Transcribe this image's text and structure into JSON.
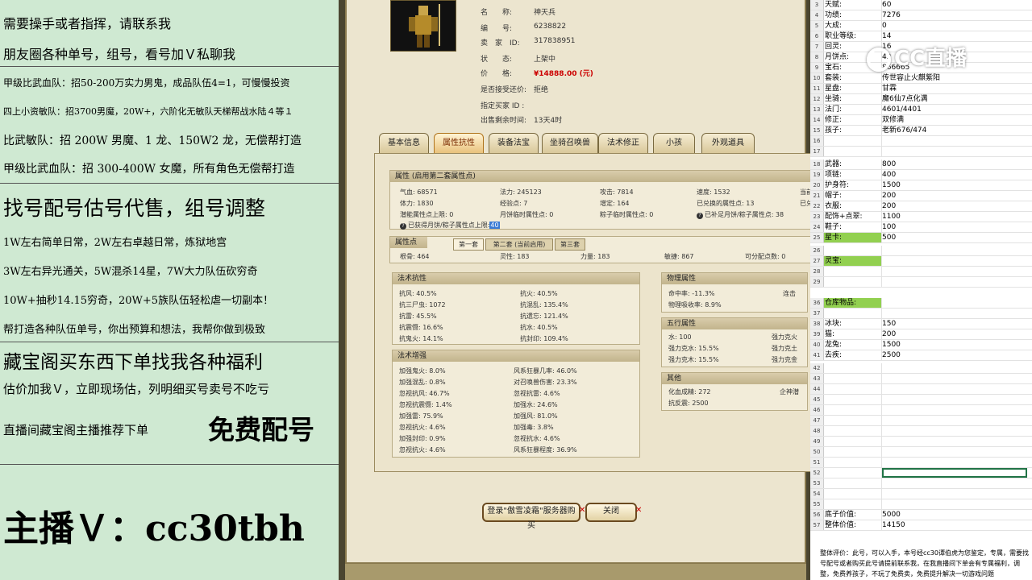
{
  "left_panel": {
    "lines": [
      "需要操手或者指挥，请联系我",
      "朋友圈各种单号，组号，看号加Ｖ私聊我",
      "甲级比武血队：招50-200万实力男鬼，成品队伍4=1，可慢慢投资",
      "四上小资敏队：招3700男魔，20W+，六阶化无敏队天梯帮战水陆４等１",
      "比武敏队：招 200W 男魔、1 龙、150W2 龙，无偿帮打造",
      "甲级比武血队：招 300-400W 女魔，所有角色无偿帮打造",
      "找号配号估号代售，组号调整",
      "1W左右简单日常，2W左右卓越日常，炼狱地宫",
      "3W左右异光通关，5W混杀14星，7W大力队伍砍穷奇",
      "10W+抽秒14.15穷奇，20W+5族队伍轻松虐一切副本！",
      "帮打造各种队伍单号，你出预算和想法，我帮你做到极致",
      "藏宝阁买东西下单找我各种福利",
      "估价加我Ｖ，立即现场估，列明细买号卖号不吃亏",
      "直播间藏宝阁主播推荐下单",
      "免费配号",
      "主播Ｖ：cc30tbh"
    ]
  },
  "game": {
    "info": {
      "name_label": "名　　称:",
      "name_value": "神天兵",
      "id_label": "编　　号:",
      "id_value": "6238822",
      "seller_label": "卖　家　ID:",
      "seller_value": "317838951",
      "status_label": "状　　态:",
      "status_value": "上架中",
      "price_label": "价　　格:",
      "price_value": "¥14888.00 (元)",
      "bargain_label": "是否接受还价:",
      "bargain_value": "拒绝",
      "buyer_label": "指定买家 ID :",
      "time_label": "出售剩余时间:",
      "time_value": "13天4时"
    },
    "tabs": [
      "基本信息",
      "属性抗性",
      "装备法宝",
      "坐骑召唤兽",
      "法术修正",
      "小孩",
      "外观道具"
    ],
    "attr_header": "属性 (启用第二套属性点)",
    "attrs": [
      [
        "气血: 68571",
        "法力: 245123",
        "攻击: 7814",
        "速度: 1532",
        "当前"
      ],
      [
        "体力: 1830",
        "经验点: 7",
        "增定: 164",
        "已兑换的属性点: 13",
        "已兑"
      ],
      [
        "潜能属性点上限: 0",
        "月饼临时属性点: 0",
        "粽子临时属性点: 0",
        "已补足月饼/粽子属性点: 38",
        ""
      ]
    ],
    "attr_note": "已获得月饼/粽子属性点上限:",
    "attr_note_value": "40",
    "points_header": "属性点",
    "sub_tabs": [
      "第一套",
      "第二套 (当前启用)",
      "第三套"
    ],
    "points": [
      "根骨: 464",
      "灵性: 183",
      "力量: 183",
      "敏捷: 867",
      "可分配点数: 0"
    ],
    "resist_header": "法术抗性",
    "resists": [
      [
        "抗风: 40.5%",
        "抗火: 40.5%"
      ],
      [
        "抗三尸虫: 1072",
        "抗混乱: 135.4%"
      ],
      [
        "抗雷: 45.5%",
        "抗遗忘: 121.4%"
      ],
      [
        "抗震慑: 16.6%",
        "抗水: 40.5%"
      ],
      [
        "抗鬼火: 14.1%",
        "抗封印: 109.4%"
      ]
    ],
    "boost_header": "法术增强",
    "boosts": [
      [
        "加强鬼火: 8.0%",
        "风系狂暴几率: 46.0%"
      ],
      [
        "加强混乱: 0.8%",
        "对召唤兽伤害: 23.3%"
      ],
      [
        "忽视抗风: 46.7%",
        "忽视抗雷: 4.6%"
      ],
      [
        "忽视抗震慑: 1.4%",
        "加强水: 24.6%"
      ],
      [
        "加强雷: 75.9%",
        "加强风: 81.0%"
      ],
      [
        "忽视抗火: 4.6%",
        "加强毒: 3.8%"
      ],
      [
        "加强封印: 0.9%",
        "忽视抗水: 4.6%"
      ],
      [
        "忽视抗火: 4.6%",
        "风系狂暴程度: 36.9%"
      ]
    ],
    "phys_header": "物理属性",
    "phys": [
      [
        "命中率: -11.3%",
        "连击"
      ],
      [
        "物理吸收率: 8.9%",
        ""
      ]
    ],
    "five_header": "五行属性",
    "five": [
      [
        "水: 100",
        "强力克火"
      ],
      [
        "强力克水: 15.5%",
        "强力克土"
      ],
      [
        "强力克木: 15.5%",
        "强力克金"
      ]
    ],
    "other_header": "其他",
    "other": [
      [
        "化血成精: 272",
        "企神潜"
      ],
      [
        "抗反震: 2500",
        ""
      ]
    ],
    "login_button": "登录\"傲雪凌霜\"服务器购买",
    "close_button": "关闭"
  },
  "logo": {
    "text": "CC直播"
  },
  "sheet": {
    "rows": [
      {
        "n": "3",
        "a": "天赋:",
        "b": "60"
      },
      {
        "n": "4",
        "a": "功绩:",
        "b": "7276"
      },
      {
        "n": "5",
        "a": "大成:",
        "b": "0"
      },
      {
        "n": "6",
        "a": "职业等级:",
        "b": "14"
      },
      {
        "n": "7",
        "a": "回灵:",
        "b": "16"
      },
      {
        "n": "8",
        "a": "月饼点:",
        "b": "42"
      },
      {
        "n": "9",
        "a": "宝石:",
        "b": "866665"
      },
      {
        "n": "10",
        "a": "套装:",
        "b": "传世容止火麒紫阳"
      },
      {
        "n": "11",
        "a": "星盘:",
        "b": "甘霖"
      },
      {
        "n": "12",
        "a": "坐骑:",
        "b": "魔6仙7点化满"
      },
      {
        "n": "13",
        "a": "法门:",
        "b": "4601/4401"
      },
      {
        "n": "14",
        "a": "修正:",
        "b": "双修满"
      },
      {
        "n": "15",
        "a": "孩子:",
        "b": "老新676/474"
      },
      {
        "n": "16",
        "a": "",
        "b": ""
      },
      {
        "n": "17",
        "a": "",
        "b": ""
      },
      {
        "n": "18",
        "a": "武器:",
        "b": "800"
      },
      {
        "n": "19",
        "a": "项链:",
        "b": "400"
      },
      {
        "n": "20",
        "a": "护身符:",
        "b": "1500"
      },
      {
        "n": "21",
        "a": "帽子:",
        "b": "200"
      },
      {
        "n": "22",
        "a": "衣服:",
        "b": "200"
      },
      {
        "n": "23",
        "a": "配饰+点翠:",
        "b": "1100"
      },
      {
        "n": "24",
        "a": "鞋子:",
        "b": "100"
      },
      {
        "n": "25",
        "a": "星卡:",
        "b": "500",
        "hl": "green"
      },
      {
        "n": "26",
        "a": "",
        "b": ""
      },
      {
        "n": "27",
        "a": "灵宝:",
        "b": "",
        "hl": "green"
      },
      {
        "n": "28",
        "a": "",
        "b": ""
      },
      {
        "n": "29",
        "a": "",
        "b": ""
      },
      {
        "n": "36",
        "a": "仓库物品:",
        "b": "",
        "hl": "green"
      },
      {
        "n": "37",
        "a": "",
        "b": ""
      },
      {
        "n": "38",
        "a": "冰块:",
        "b": "150"
      },
      {
        "n": "39",
        "a": "猫:",
        "b": "200"
      },
      {
        "n": "40",
        "a": "龙兔:",
        "b": "1500"
      },
      {
        "n": "41",
        "a": "去疾:",
        "b": "2500"
      },
      {
        "n": "42",
        "a": "",
        "b": ""
      },
      {
        "n": "43",
        "a": "",
        "b": ""
      },
      {
        "n": "44",
        "a": "",
        "b": ""
      },
      {
        "n": "45",
        "a": "",
        "b": ""
      },
      {
        "n": "46",
        "a": "",
        "b": ""
      },
      {
        "n": "47",
        "a": "",
        "b": ""
      },
      {
        "n": "48",
        "a": "",
        "b": ""
      },
      {
        "n": "49",
        "a": "",
        "b": ""
      },
      {
        "n": "50",
        "a": "",
        "b": ""
      },
      {
        "n": "51",
        "a": "",
        "b": ""
      },
      {
        "n": "52",
        "a": "",
        "b": "",
        "sel": true
      },
      {
        "n": "53",
        "a": "",
        "b": ""
      },
      {
        "n": "54",
        "a": "",
        "b": ""
      },
      {
        "n": "55",
        "a": "",
        "b": ""
      },
      {
        "n": "56",
        "a": "底子价值:",
        "b": "5000"
      },
      {
        "n": "57",
        "a": "整体价值:",
        "b": "14150"
      }
    ],
    "footer": "整体评价：此号，可以入手，本号经cc30谭伯虎为您鉴定，专属，需要找号配号或者购买此号请提前联系我，在我直播间下单会有专属福利，调整，免费养孩子，不玩了免费卖，免费提升解决一切游戏问题"
  }
}
